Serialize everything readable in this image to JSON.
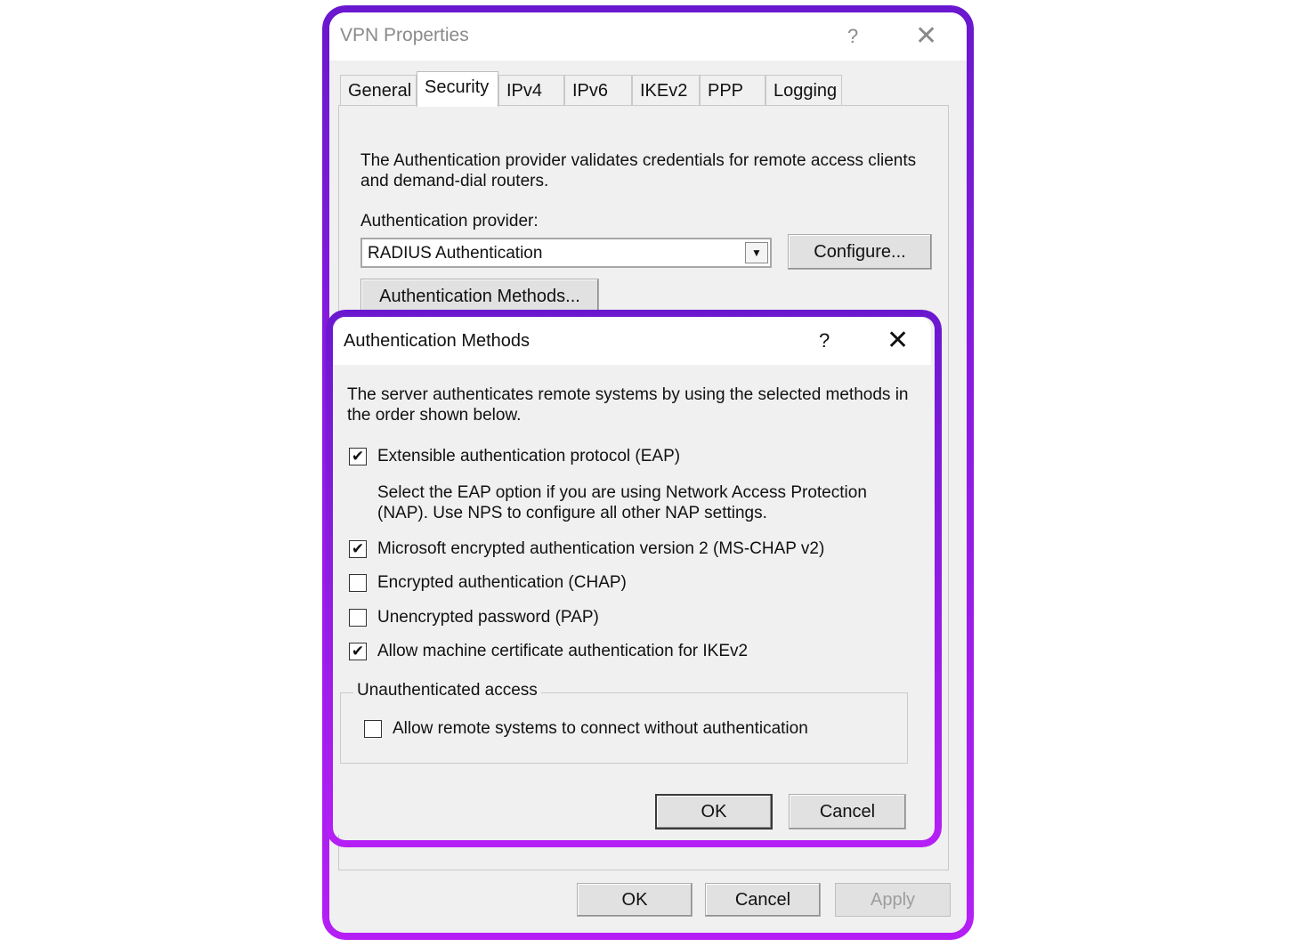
{
  "vpn_dialog": {
    "title": "VPN Properties",
    "help_glyph": "?",
    "close_glyph": "✕",
    "tabs": [
      {
        "label": "General"
      },
      {
        "label": "Security"
      },
      {
        "label": "IPv4"
      },
      {
        "label": "IPv6"
      },
      {
        "label": "IKEv2"
      },
      {
        "label": "PPP"
      },
      {
        "label": "Logging"
      }
    ],
    "active_tab": "Security",
    "security": {
      "description_line1": "The Authentication provider validates credentials for remote access clients",
      "description_line2": "and demand-dial routers.",
      "provider_label": "Authentication provider:",
      "provider_value": "RADIUS Authentication",
      "configure_label": "Configure...",
      "methods_label": "Authentication Methods..."
    },
    "footer": {
      "ok": "OK",
      "cancel": "Cancel",
      "apply": "Apply"
    }
  },
  "auth_dialog": {
    "title": "Authentication Methods",
    "help_glyph": "?",
    "close_glyph": "✕",
    "intro_line1": "The server authenticates remote systems by using the selected methods in",
    "intro_line2": "the order shown below.",
    "methods": [
      {
        "label": "Extensible authentication protocol (EAP)",
        "checked": true
      },
      {
        "label": "Microsoft encrypted authentication version 2 (MS-CHAP v2)",
        "checked": true
      },
      {
        "label": "Encrypted authentication (CHAP)",
        "checked": false
      },
      {
        "label": "Unencrypted password (PAP)",
        "checked": false
      },
      {
        "label": "Allow machine certificate authentication for IKEv2",
        "checked": true
      }
    ],
    "eap_note_line1": "Select the EAP option if you are using Network Access Protection",
    "eap_note_line2": "(NAP). Use NPS to configure all other NAP settings.",
    "unauth_group_label": "Unauthenticated access",
    "unauth_option": {
      "label": "Allow remote systems to connect without authentication",
      "checked": false
    },
    "ok": "OK",
    "cancel": "Cancel"
  },
  "colors": {
    "frame_top": "#6a18cf",
    "frame_bottom": "#b51ff5"
  }
}
